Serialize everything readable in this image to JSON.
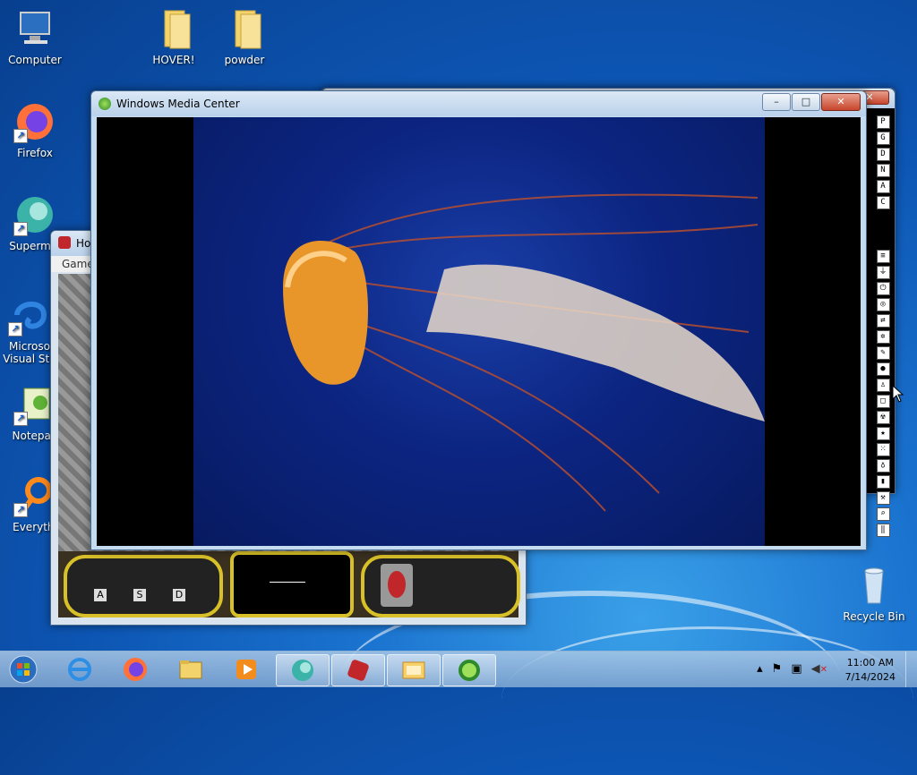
{
  "desktop_icons": [
    {
      "label": "Computer",
      "icon": "computer-icon"
    },
    {
      "label": "HOVER!",
      "icon": "folder-icon"
    },
    {
      "label": "powder",
      "icon": "folder-icon"
    },
    {
      "label": "Firefox",
      "icon": "firefox-icon"
    },
    {
      "label": "Supermiu",
      "icon": "supermium-icon"
    },
    {
      "label": "Microso Visual Stu",
      "icon": "visual-studio-icon"
    },
    {
      "label": "Notepad",
      "icon": "notepad-icon"
    },
    {
      "label": "Everythi",
      "icon": "everything-search-icon"
    },
    {
      "label": "Recycle Bin",
      "icon": "recycle-bin-icon"
    }
  ],
  "media_center": {
    "title": "Windows Media Center",
    "buttons": {
      "minimize": "–",
      "maximize": "□",
      "close": "✕"
    }
  },
  "hover_game": {
    "title_partial": "Ho",
    "menu_partial": "Game",
    "hud_labels": [
      "A",
      "S",
      "D"
    ]
  },
  "powder_toolbar": {
    "letters": [
      "P",
      "G",
      "D",
      "N",
      "A",
      "C"
    ],
    "tools": [
      "menu-icon",
      "plug-icon",
      "power-icon",
      "circle-icon",
      "arrows-icon",
      "settings-icon",
      "pencil-icon",
      "drop-icon",
      "person-icon",
      "square-icon",
      "radiation-icon",
      "star-icon",
      "grid-icon",
      "bulb-icon",
      "bookmark-icon",
      "hammer-icon",
      "search-icon",
      "pause-icon"
    ]
  },
  "taskbar": {
    "apps": [
      "ie-icon",
      "firefox-icon",
      "explorer-icon",
      "media-player-icon",
      "supermium-icon",
      "hover-game-icon",
      "powder-icon",
      "media-center-icon"
    ],
    "time": "11:00 AM",
    "date": "7/14/2024"
  },
  "colors": {
    "accent": "#1b74d0",
    "titlebar": "#c5dbf0",
    "close": "#c8452c"
  }
}
